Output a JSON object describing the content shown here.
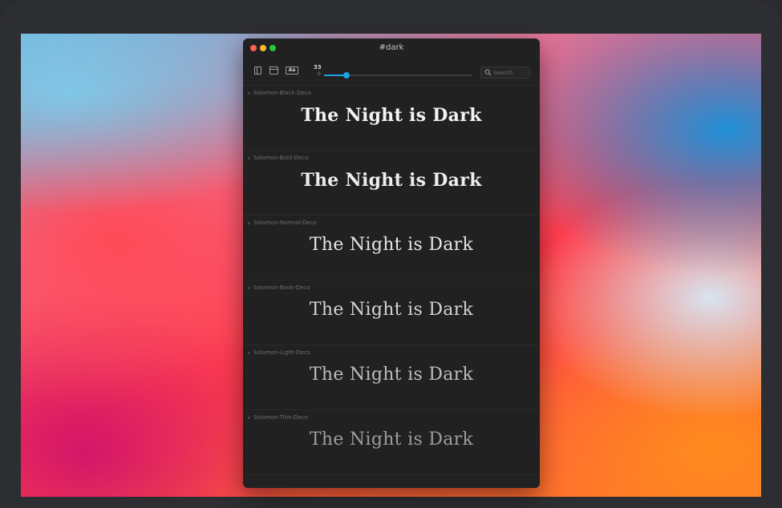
{
  "window": {
    "title": "#dark"
  },
  "toolbar": {
    "preview_icon_label": "Aa",
    "size_value": "33",
    "size_min": "0",
    "size_fraction": 0.15
  },
  "search": {
    "placeholder": "Search",
    "value": ""
  },
  "icons": {
    "close": "close-dot",
    "minimize": "minimize-dot",
    "zoom": "zoom-dot",
    "sidebar": "sidebar-icon",
    "window": "window-icon",
    "preview": "preview-icon",
    "search": "search-icon",
    "disclosure": "chevron-right-icon"
  },
  "colors": {
    "accent": "#1aa1e6",
    "window_bg": "#212121"
  },
  "fonts": [
    {
      "name": "Solomon-Black-Deco",
      "sample": "The Night is Dark"
    },
    {
      "name": "Solomon-Bold-Deco",
      "sample": "The Night is Dark"
    },
    {
      "name": "Solomon-Normal-Deco",
      "sample": "The Night is Dark"
    },
    {
      "name": "Solomon-Book-Deco",
      "sample": "The Night is Dark"
    },
    {
      "name": "Solomon-Light-Deco",
      "sample": "The Night is Dark"
    },
    {
      "name": "Solomon-Thin-Deco",
      "sample": "The Night is Dark"
    }
  ]
}
